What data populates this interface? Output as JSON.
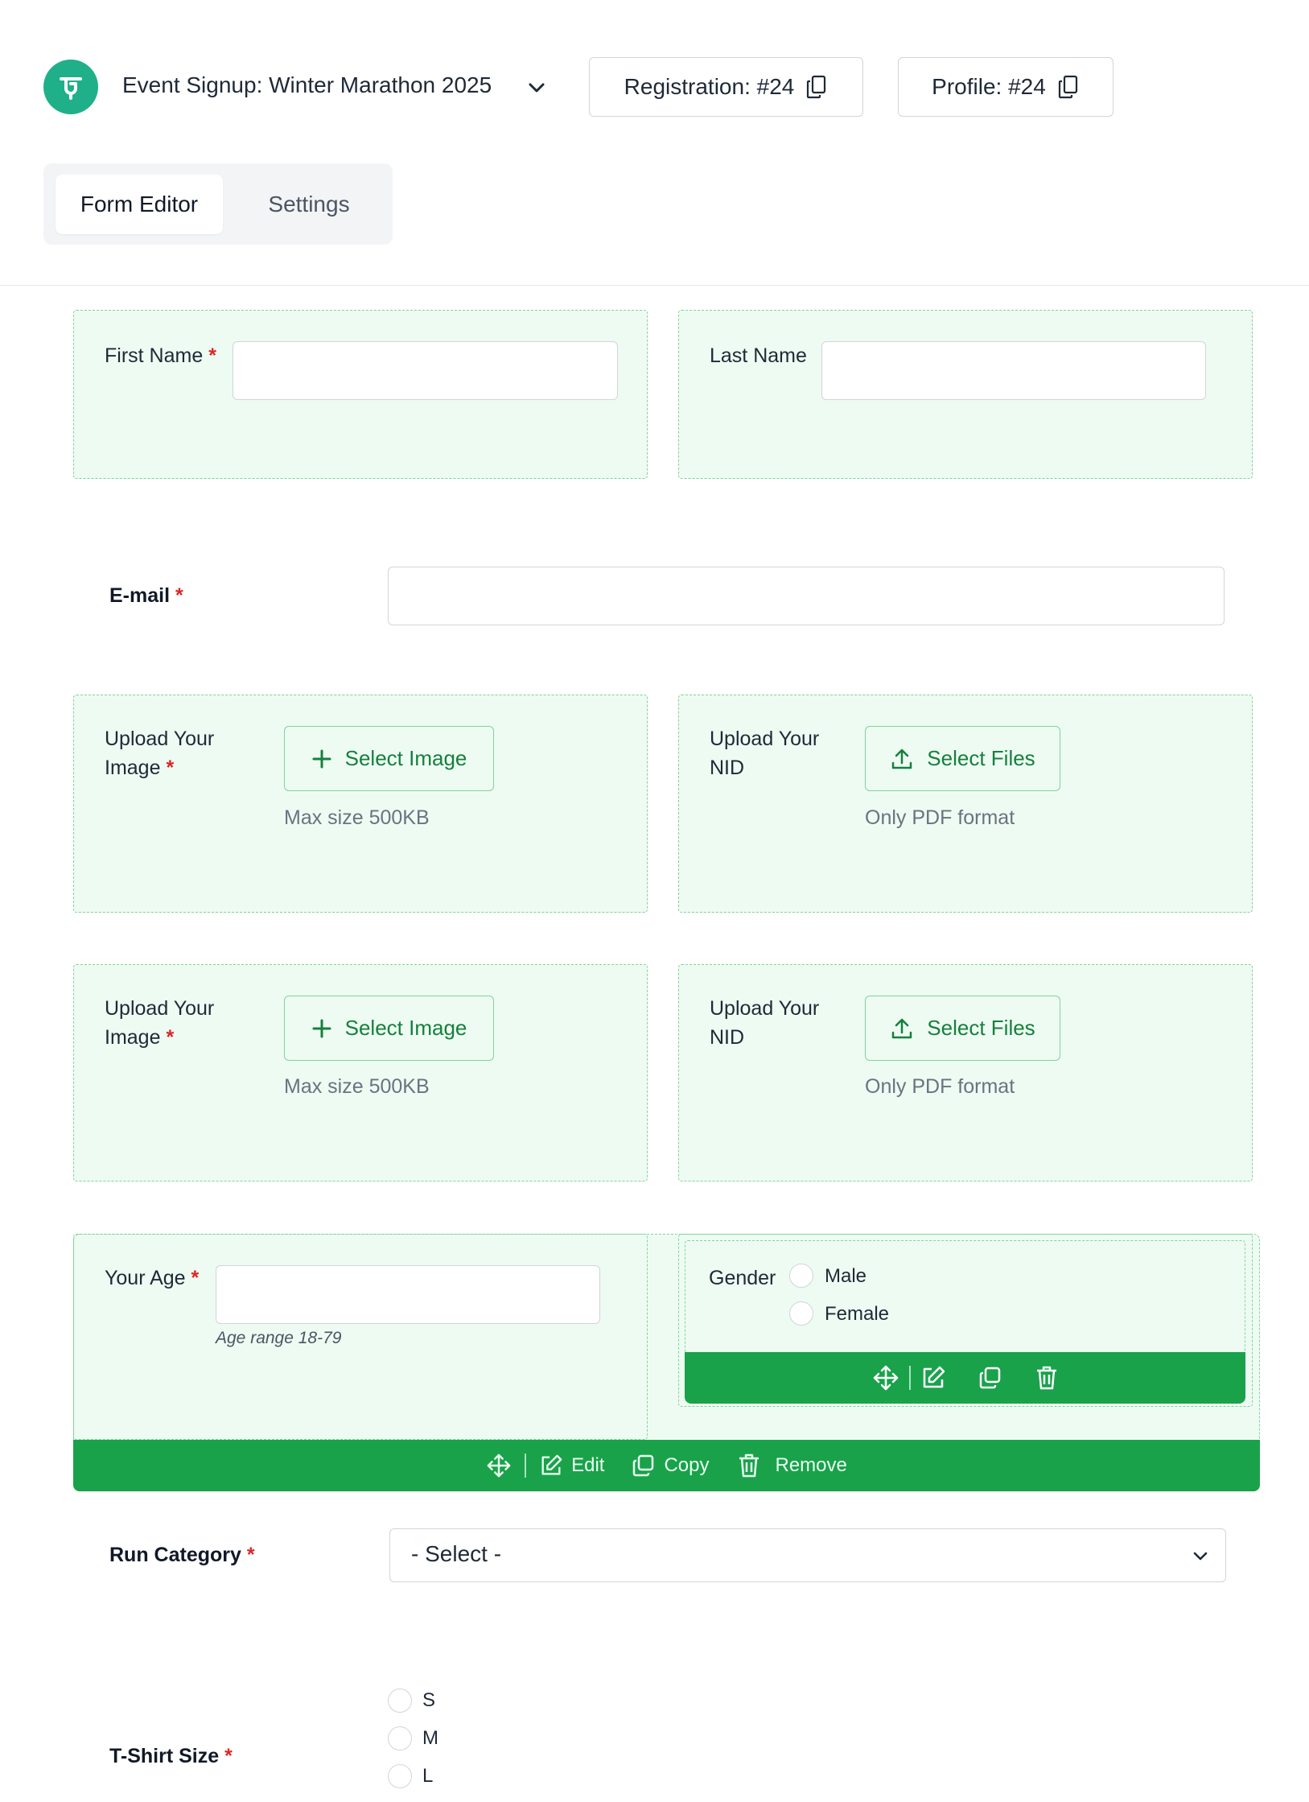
{
  "header": {
    "form_title": "Event Signup: Winter Marathon 2025",
    "registration_label": "Registration: #24",
    "profile_label": "Profile: #24"
  },
  "tabs": [
    {
      "label": "Form Editor",
      "active": true
    },
    {
      "label": "Settings",
      "active": false
    }
  ],
  "fields": {
    "first_name": {
      "label": "First Name",
      "required": "*",
      "value": ""
    },
    "last_name": {
      "label": "Last Name",
      "value": ""
    },
    "email": {
      "label": "E-mail",
      "required": "*",
      "value": ""
    },
    "upload_image_1": {
      "label_line1": "Upload Your",
      "label_line2": "Image",
      "required": "*",
      "button": "Select Image",
      "hint": "Max size 500KB"
    },
    "upload_nid_1": {
      "label_line1": "Upload Your",
      "label_line2": "NID",
      "button": "Select Files",
      "hint": "Only PDF format"
    },
    "upload_image_2": {
      "label_line1": "Upload Your",
      "label_line2": "Image",
      "required": "*",
      "button": "Select Image",
      "hint": "Max size 500KB"
    },
    "upload_nid_2": {
      "label_line1": "Upload Your",
      "label_line2": "NID",
      "button": "Select Files",
      "hint": "Only PDF format"
    },
    "age": {
      "label": "Your Age",
      "required": "*",
      "value": "",
      "hint": "Age range 18-79"
    },
    "gender": {
      "label": "Gender",
      "options": [
        "Male",
        "Female"
      ]
    },
    "run_category": {
      "label": "Run Category",
      "required": "*",
      "selected": "- Select -"
    },
    "tshirt": {
      "label": "T-Shirt Size",
      "required": "*",
      "options": [
        "S",
        "M",
        "L"
      ]
    }
  },
  "toolbar": {
    "edit_label": "Edit",
    "copy_label": "Copy",
    "remove_label": "Remove"
  },
  "colors": {
    "accent_green": "#19a24a",
    "field_bg": "#eefbf2",
    "logo_teal": "#1fb08a",
    "required_red": "#dc2626"
  },
  "icons": [
    "logo-icon",
    "chevron-down-icon",
    "copy-icon",
    "plus-icon",
    "upload-icon",
    "move-icon",
    "edit-icon",
    "trash-icon"
  ]
}
